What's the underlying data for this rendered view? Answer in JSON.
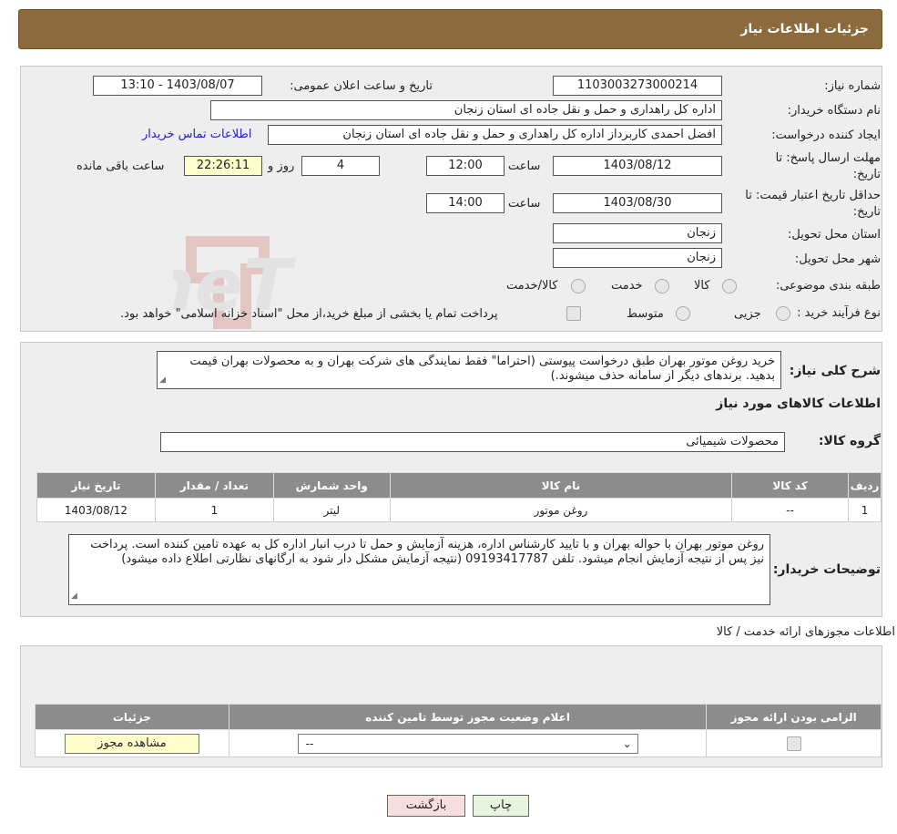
{
  "header": {
    "title": "جزئیات اطلاعات نیاز"
  },
  "form": {
    "need_number_label": "شماره نیاز:",
    "need_number": "1103003273000214",
    "announce_label": "تاریخ و ساعت اعلان عمومی:",
    "announce_value": "1403/08/07 - 13:10",
    "buyer_org_label": "نام دستگاه خریدار:",
    "buyer_org": "اداره کل راهداری و حمل و نقل جاده ای استان زنجان",
    "requester_label": "ایجاد کننده درخواست:",
    "requester": "افضل احمدی کاربرداز اداره کل راهداری و حمل و نقل جاده ای استان زنجان",
    "contact_link": "اطلاعات تماس خریدار",
    "deadline_label_1": "مهلت ارسال پاسخ: تا",
    "deadline_label_2": "تاریخ:",
    "deadline_date": "1403/08/12",
    "time_label": "ساعت",
    "deadline_time": "12:00",
    "days_value": "4",
    "days_label": "روز و",
    "remaining_time": "22:26:11",
    "remaining_label": "ساعت باقی مانده",
    "validity_label_1": "حداقل تاریخ اعتبار قیمت: تا",
    "validity_label_2": "تاریخ:",
    "validity_date": "1403/08/30",
    "validity_time": "14:00",
    "province_label": "استان محل تحویل:",
    "province": "زنجان",
    "city_label": "شهر محل تحویل:",
    "city": "زنجان",
    "category_label": "طبقه بندی موضوعی:",
    "category_options": [
      "کالا",
      "خدمت",
      "کالا/خدمت"
    ],
    "purchase_type_label": "نوع فرآیند خرید :",
    "purchase_options": [
      "جزیی",
      "متوسط"
    ],
    "purchase_note": "پرداخت تمام یا بخشی از مبلغ خرید،از محل \"اسناد خزانه اسلامی\" خواهد بود."
  },
  "summary": {
    "label": "شرح کلی نیاز:",
    "text": "خرید روغن موتور بهران طبق درخواست پیوستی (احتراما\" فقط نمایندگی های شرکت بهران و به محصولات بهران قیمت بدهید. برندهای دیگر از سامانه حذف میشوند.)",
    "goods_info_title": "اطلاعات کالاهای مورد نیاز",
    "goods_group_label": "گروه کالا:",
    "goods_group": "محصولات شیمیائی"
  },
  "goods_table": {
    "headers": [
      "ردیف",
      "کد کالا",
      "نام کالا",
      "واحد شمارش",
      "تعداد / مقدار",
      "تاریخ نیاز"
    ],
    "rows": [
      [
        "1",
        "--",
        "روغن موتور",
        "لیتر",
        "1",
        "1403/08/12"
      ]
    ]
  },
  "buyer_notes": {
    "label": "توضیحات خریدار:",
    "text": "روغن موتور بهران با حواله بهران و با تایید کارشناس اداره، هزینه آزمایش و حمل تا درب انبار اداره کل به عهده تامین کننده است. پرداخت نیز پس از نتیجه آزمایش انجام میشود. تلفن 09193417787 (نتیجه آزمایش مشکل دار شود به ارگانهای نظارتی اطلاع داده میشود)"
  },
  "permits": {
    "title": "اطلاعات مجوزهای ارائه خدمت / کالا",
    "headers": [
      "الزامی بودن ارائه مجوز",
      "اعلام وضعیت مجوز توسط تامین کننده",
      "جزئیات"
    ],
    "select_value": "--",
    "view_button": "مشاهده مجوز"
  },
  "buttons": {
    "print": "چاپ",
    "back": "بازگشت"
  },
  "watermark": {
    "text": "AriaTender.neT"
  }
}
